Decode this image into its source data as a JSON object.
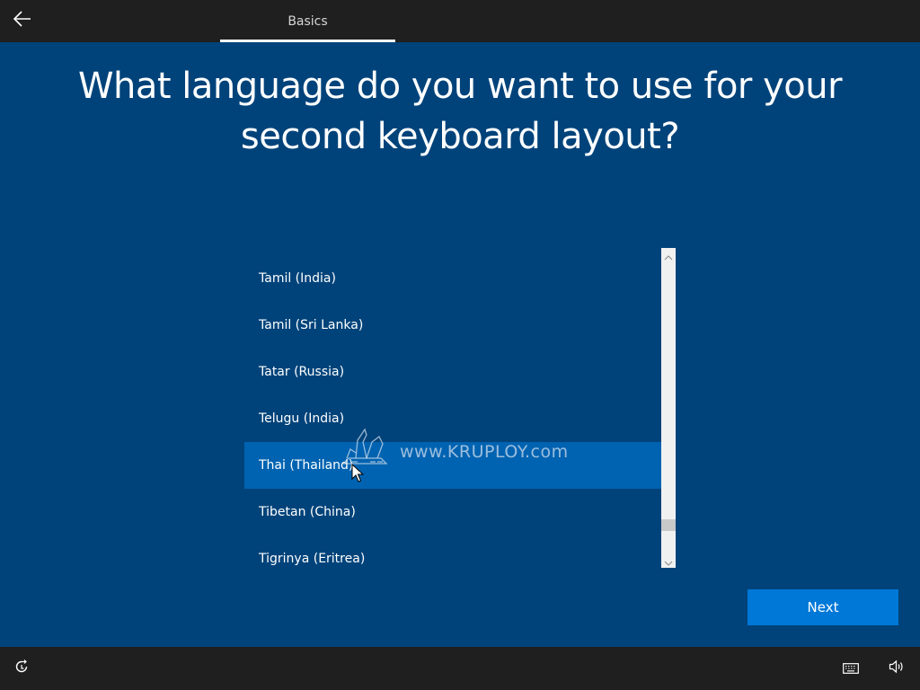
{
  "header": {
    "back_icon": "arrow-left-icon",
    "tab_label": "Basics"
  },
  "main": {
    "title_line1": "What language do you want to use for your",
    "title_line2": "second keyboard layout?"
  },
  "language_list": {
    "items": [
      {
        "label": "Tamil (India)"
      },
      {
        "label": "Tamil (Sri Lanka)"
      },
      {
        "label": "Tatar (Russia)"
      },
      {
        "label": "Telugu (India)"
      },
      {
        "label": "Thai (Thailand)",
        "selected": true
      },
      {
        "label": "Tibetan (China)"
      },
      {
        "label": "Tigrinya (Eritrea)"
      }
    ],
    "selected_index": 4
  },
  "watermark": {
    "text": "www.KRUPLOY.com"
  },
  "actions": {
    "next_label": "Next"
  },
  "footer": {
    "left_icon": "ease-of-access-icon",
    "right_icons": [
      "keyboard-icon",
      "volume-icon"
    ]
  },
  "colors": {
    "background": "#00437a",
    "bars": "#1f1f1f",
    "selected_item": "#0063b1",
    "accent_button": "#0078d7"
  }
}
